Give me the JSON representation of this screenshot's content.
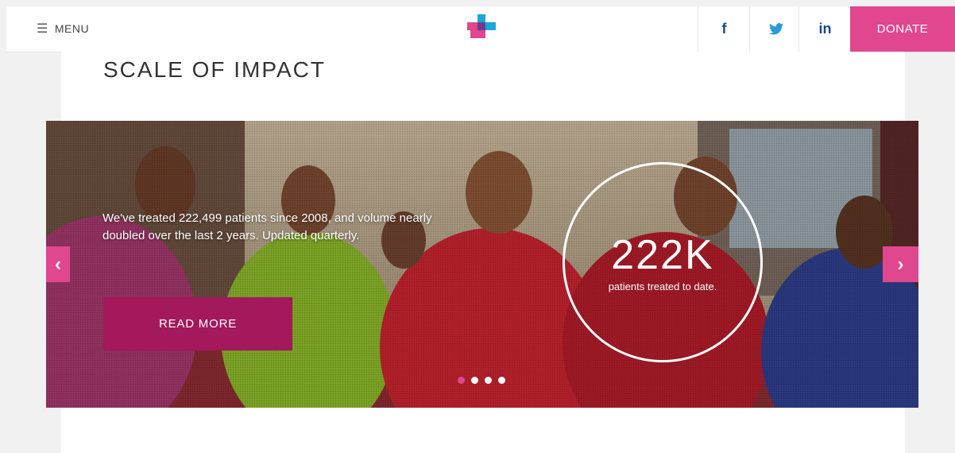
{
  "header": {
    "menu_icon": "☰",
    "menu_label": "MENU",
    "social": {
      "facebook": "f",
      "twitter": "t",
      "linkedin": "in"
    },
    "donate_label": "DONATE"
  },
  "section": {
    "title": "SCALE OF IMPACT"
  },
  "slide": {
    "lead_text": "We've treated 222,499 patients since 2008, and volume nearly doubled over the last 2 years. Updated quarterly.",
    "read_more_label": "READ MORE",
    "stat_value": "222K",
    "stat_label": "patients treated to date.",
    "prev_arrow": "‹",
    "next_arrow": "›",
    "slide_count": 4,
    "active_slide_index": 0
  },
  "colors": {
    "brand_pink": "#e0478f",
    "button_magenta": "#a3195b",
    "logo_blue": "#19a8d8",
    "social_blue": "#174a8b"
  }
}
